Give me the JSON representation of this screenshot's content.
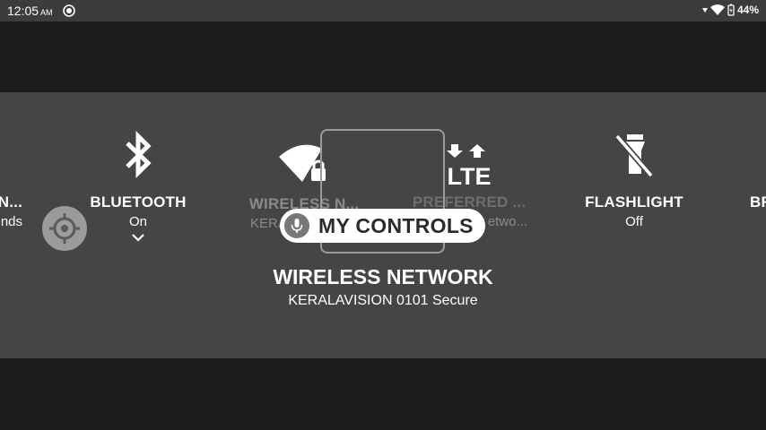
{
  "status_bar": {
    "time": "12:05",
    "ampm": "AM",
    "battery": "44%",
    "icons": [
      "camera-indicator-icon",
      "wifi-icon",
      "battery-icon"
    ]
  },
  "tiles": {
    "left_partial": {
      "label": "N...",
      "status": "nds"
    },
    "bluetooth": {
      "label": "BLUETOOTH",
      "status": "On",
      "icon": "bluetooth-icon"
    },
    "wireless": {
      "label": "WIRELESS N...",
      "status": "KERA",
      "icon": "wifi-lock-icon"
    },
    "preferred": {
      "label": "PREFERRED ...",
      "status": "etwo...",
      "icon": "lte-icon"
    },
    "flashlight": {
      "label": "FLASHLIGHT",
      "status": "Off",
      "icon": "flashlight-off-icon"
    },
    "right_partial": {
      "label": "BR"
    }
  },
  "overlay": {
    "my_controls_label": "MY CONTROLS"
  },
  "focused": {
    "title": "WIRELESS NETWORK",
    "subtitle": "KERALAVISION 0101 Secure"
  }
}
